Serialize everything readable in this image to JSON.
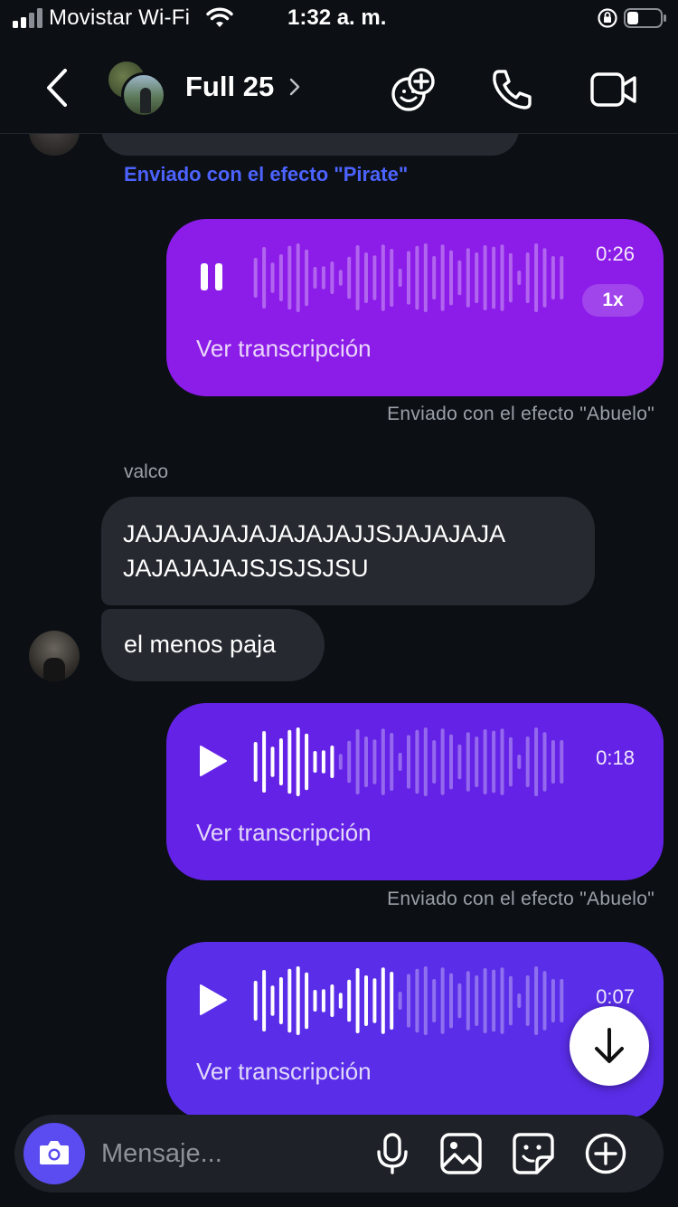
{
  "status_bar": {
    "carrier": "Movistar Wi-Fi",
    "time": "1:32 a. m."
  },
  "header": {
    "title": "Full 25",
    "icons": [
      "back-chevron-icon",
      "avatar-group",
      "effects-icon",
      "phone-icon",
      "video-camera-icon"
    ]
  },
  "messages": {
    "effect_pirate": "Enviado con el efecto \"Pirate\"",
    "voice_1": {
      "state": "playing",
      "duration": "0:26",
      "speed": "1x",
      "transcript_label": "Ver transcripción",
      "progress": 0.0,
      "color": "#8c1ce8"
    },
    "effect_abuelo_1": "Enviado con el efecto \"Abuelo\"",
    "sender": "valco",
    "text_1": "JAJAJAJAJAJAJAJAJJSJAJAJAJAJAJAJAJAJSJSJSJSU",
    "text_1_line1": "JAJAJAJAJAJAJAJAJJSJAJAJAJA",
    "text_1_line2": "JAJAJAJAJSJSJSJSU",
    "text_2": "el menos paja",
    "voice_2": {
      "state": "paused",
      "duration": "0:18",
      "transcript_label": "Ver transcripción",
      "played_fraction": 0.27,
      "color": "#6422e6"
    },
    "effect_abuelo_2": "Enviado con el efecto \"Abuelo\"",
    "voice_3": {
      "state": "paused",
      "duration": "0:07",
      "transcript_label": "Ver transcripción",
      "played_fraction": 0.44,
      "color": "#5a2de8"
    }
  },
  "composer": {
    "placeholder": "Mensaje...",
    "icons": [
      "camera-icon",
      "microphone-icon",
      "gallery-icon",
      "sticker-icon",
      "plus-circle-icon"
    ],
    "accent": "#5a4cf0"
  }
}
